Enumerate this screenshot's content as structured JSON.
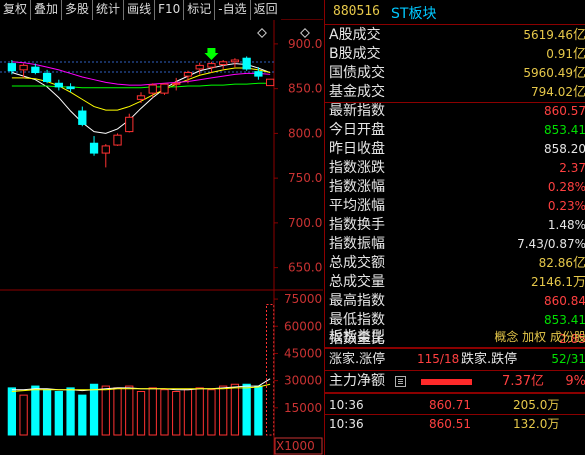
{
  "toolbar": {
    "buttons": [
      "复权",
      "叠加",
      "多股",
      "统计",
      "画线",
      "F10",
      "标记",
      "-自选",
      "返回"
    ]
  },
  "chart": {
    "price_axis": [
      "900.0",
      "850.0",
      "800.0",
      "750.0",
      "700.0",
      "650.0"
    ],
    "volume_axis": [
      "75000",
      "60000",
      "45000",
      "30000",
      "15000"
    ],
    "volume_unit": "X1000",
    "colors": {
      "up": "#ff3232",
      "down": "#00ffff",
      "ma_white": "#ffffff",
      "ma_yellow": "#ffff00",
      "ma_magenta": "#ff00ff",
      "ma_green": "#00ff00",
      "grid": "#8b0000",
      "marker": "#00ff00"
    }
  },
  "chart_data": {
    "type": "candlestick",
    "ylim": [
      625,
      920
    ],
    "volume_ylim": [
      0,
      80000
    ],
    "candles": [
      {
        "o": 878,
        "h": 882,
        "l": 866,
        "c": 870
      },
      {
        "o": 871,
        "h": 878,
        "l": 862,
        "c": 876
      },
      {
        "o": 874,
        "h": 878,
        "l": 866,
        "c": 868
      },
      {
        "o": 867,
        "h": 871,
        "l": 856,
        "c": 858
      },
      {
        "o": 856,
        "h": 860,
        "l": 848,
        "c": 852
      },
      {
        "o": 852,
        "h": 856,
        "l": 846,
        "c": 850
      },
      {
        "o": 825,
        "h": 830,
        "l": 808,
        "c": 810
      },
      {
        "o": 789,
        "h": 797,
        "l": 775,
        "c": 778
      },
      {
        "o": 778,
        "h": 788,
        "l": 762,
        "c": 786
      },
      {
        "o": 787,
        "h": 800,
        "l": 786,
        "c": 798
      },
      {
        "o": 802,
        "h": 822,
        "l": 801,
        "c": 818
      },
      {
        "o": 838,
        "h": 846,
        "l": 834,
        "c": 842
      },
      {
        "o": 845,
        "h": 856,
        "l": 840,
        "c": 854
      },
      {
        "o": 845,
        "h": 856,
        "l": 843,
        "c": 855
      },
      {
        "o": 856,
        "h": 862,
        "l": 848,
        "c": 856
      },
      {
        "o": 864,
        "h": 870,
        "l": 856,
        "c": 868
      },
      {
        "o": 872,
        "h": 879,
        "l": 866,
        "c": 876
      },
      {
        "o": 874,
        "h": 880,
        "l": 868,
        "c": 878
      },
      {
        "o": 877,
        "h": 882,
        "l": 872,
        "c": 880
      },
      {
        "o": 880,
        "h": 884,
        "l": 874,
        "c": 882
      },
      {
        "o": 884,
        "h": 886,
        "l": 870,
        "c": 872
      },
      {
        "o": 869,
        "h": 874,
        "l": 860,
        "c": 864
      },
      {
        "o": 853.41,
        "h": 860.84,
        "l": 853.41,
        "c": 860.57
      }
    ],
    "volume": [
      26000,
      22000,
      27000,
      25000,
      24000,
      26000,
      22000,
      28000,
      27000,
      26000,
      27000,
      24000,
      26000,
      25000,
      24000,
      25000,
      26000,
      25000,
      27000,
      28000,
      28000,
      27000,
      72000
    ],
    "ma": [
      {
        "color": "#ffffff",
        "values": [
          868,
          864,
          860,
          852,
          840,
          825,
          812,
          802,
          800,
          805,
          815,
          828,
          840,
          850,
          858,
          864,
          870,
          873,
          876,
          878,
          877,
          873,
          868
        ]
      },
      {
        "color": "#ffff00",
        "values": [
          862,
          862,
          861,
          858,
          853,
          846,
          838,
          830,
          826,
          826,
          830,
          836,
          843,
          849,
          855,
          860,
          865,
          868,
          871,
          873,
          873,
          871,
          868
        ]
      },
      {
        "color": "#ff00ff",
        "values": [
          880,
          879,
          877,
          874,
          871,
          867,
          863,
          860,
          857,
          855,
          854,
          854,
          855,
          856,
          857,
          858,
          860,
          862,
          864,
          866,
          867,
          867,
          866
        ]
      },
      {
        "color": "#00ff00",
        "values": [
          853,
          853,
          853,
          853,
          852,
          852,
          851,
          851,
          851,
          851,
          851,
          851,
          852,
          852,
          852,
          853,
          853,
          854,
          854,
          855,
          855,
          856,
          856
        ]
      }
    ],
    "vol_ma": [
      {
        "color": "#ffffff",
        "values": [
          25000,
          25000,
          25500,
          25500,
          25000,
          25000,
          24500,
          25000,
          25500,
          26000,
          26000,
          25500,
          25500,
          25500,
          25000,
          25000,
          25500,
          25500,
          26000,
          26500,
          27000,
          27000,
          31000
        ]
      },
      {
        "color": "#ffff00",
        "values": [
          24000,
          24500,
          25000,
          25000,
          25000,
          25000,
          25000,
          25000,
          25000,
          25500,
          25500,
          25500,
          25500,
          25500,
          25500,
          25500,
          25500,
          25500,
          25500,
          26000,
          26000,
          26500,
          28000
        ]
      }
    ]
  },
  "panel": {
    "code": "880516",
    "name": "ST板块",
    "rows": [
      {
        "label": "A股成交",
        "value": "5619.46",
        "unit": "亿",
        "color": "#e6c84a"
      },
      {
        "label": "B股成交",
        "value": "0.91",
        "unit": "亿",
        "color": "#e6c84a"
      },
      {
        "label": "国债成交",
        "value": "5960.49",
        "unit": "亿",
        "color": "#e6c84a"
      },
      {
        "label": "基金成交",
        "value": "794.02",
        "unit": "亿",
        "color": "#e6c84a"
      },
      {
        "label": "最新指数",
        "value": "860.57",
        "unit": "",
        "color": "#ff4040"
      },
      {
        "label": "今日开盘",
        "value": "853.41",
        "unit": "",
        "color": "#00e000"
      },
      {
        "label": "昨日收盘",
        "value": "858.20",
        "unit": "",
        "color": "#e6e6e6"
      },
      {
        "label": "指数涨跌",
        "value": "2.37",
        "unit": "",
        "color": "#ff4040"
      },
      {
        "label": "指数涨幅",
        "value": "0.28%",
        "unit": "",
        "color": "#ff4040"
      },
      {
        "label": "平均涨幅",
        "value": "0.23%",
        "unit": "",
        "color": "#ff4040"
      },
      {
        "label": "指数换手",
        "value": "1.48%",
        "unit": "",
        "color": "#e6e6e6"
      },
      {
        "label": "指数振幅",
        "value": "7.43/0.87%",
        "unit": "",
        "color": "#e6e6e6"
      },
      {
        "label": "总成交额",
        "value": "82.86",
        "unit": "亿",
        "color": "#e6c84a"
      },
      {
        "label": "总成交量",
        "value": "2146.1",
        "unit": "万",
        "color": "#e6c84a"
      },
      {
        "label": "最高指数",
        "value": "860.84",
        "unit": "",
        "color": "#ff4040"
      },
      {
        "label": "最低指数",
        "value": "853.41",
        "unit": "",
        "color": "#00e000"
      },
      {
        "label": "指数量比",
        "value": "2.85",
        "unit": "",
        "color": "#ff4040"
      }
    ],
    "type_label": "板指类型",
    "type_value": "概念 加权 成份股",
    "updown": {
      "rise_label": "涨家.涨停",
      "rise_value": "115/18",
      "fall_label": "跌家.跌停",
      "fall_value": "52/31"
    },
    "net_flow": {
      "label": "主力净额",
      "value": "7.37亿",
      "pct": "9%",
      "fill": 0.09
    },
    "ticks": [
      {
        "time": "10:36",
        "price": "860.71",
        "vol": "205.0万"
      },
      {
        "time": "10:36",
        "price": "860.51",
        "vol": "132.0万"
      }
    ]
  }
}
